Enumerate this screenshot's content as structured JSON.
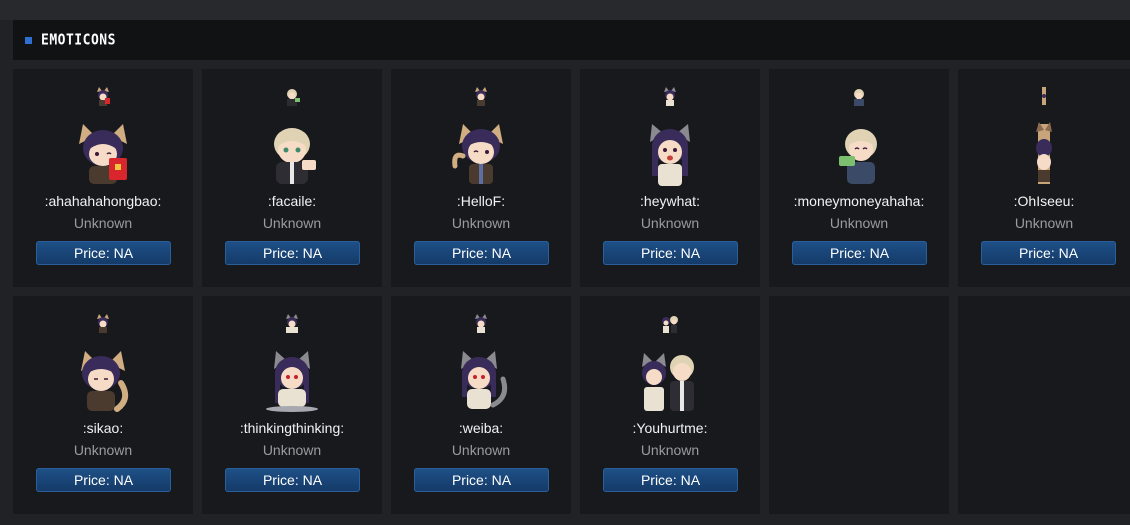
{
  "section": {
    "title": "EMOTICONS",
    "accent_color": "#2f6fd1"
  },
  "emoticons": [
    {
      "name": ":ahahahahongbao:",
      "status": "Unknown",
      "price": "Price: NA",
      "icon": "cat-boy-red-envelope-icon"
    },
    {
      "name": ":facaile:",
      "status": "Unknown",
      "price": "Price: NA",
      "icon": "blond-boy-money-icon"
    },
    {
      "name": ":HelloF:",
      "status": "Unknown",
      "price": "Price: NA",
      "icon": "cat-boy-waving-icon"
    },
    {
      "name": ":heywhat:",
      "status": "Unknown",
      "price": "Price: NA",
      "icon": "cat-girl-surprised-icon"
    },
    {
      "name": ":moneymoneyahaha:",
      "status": "Unknown",
      "price": "Price: NA",
      "icon": "blond-boy-cash-icon"
    },
    {
      "name": ":OhIseeu:",
      "status": "Unknown",
      "price": "Price: NA",
      "icon": "peeking-cat-icon"
    },
    {
      "name": ":sikao:",
      "status": "Unknown",
      "price": "Price: NA",
      "icon": "cat-boy-thinking-icon"
    },
    {
      "name": ":thinkingthinking:",
      "status": "Unknown",
      "price": "Price: NA",
      "icon": "cat-girl-sitting-icon"
    },
    {
      "name": ":weiba:",
      "status": "Unknown",
      "price": "Price: NA",
      "icon": "cat-girl-tail-icon"
    },
    {
      "name": ":Youhurtme:",
      "status": "Unknown",
      "price": "Price: NA",
      "icon": "couple-icon"
    }
  ]
}
